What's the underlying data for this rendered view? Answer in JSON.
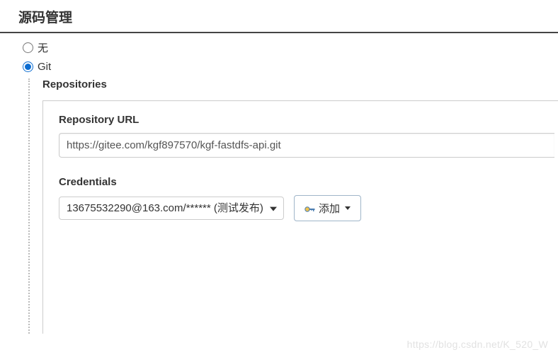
{
  "section": {
    "title": "源码管理"
  },
  "scm": {
    "none_label": "无",
    "git_label": "Git",
    "selected": "git"
  },
  "repositories": {
    "label": "Repositories",
    "url_label": "Repository URL",
    "url_value": "https://gitee.com/kgf897570/kgf-fastdfs-api.git",
    "credentials_label": "Credentials",
    "credentials_selected": "13675532290@163.com/****** (测试发布)",
    "add_button_label": "添加"
  },
  "watermark": "https://blog.csdn.net/K_520_W"
}
